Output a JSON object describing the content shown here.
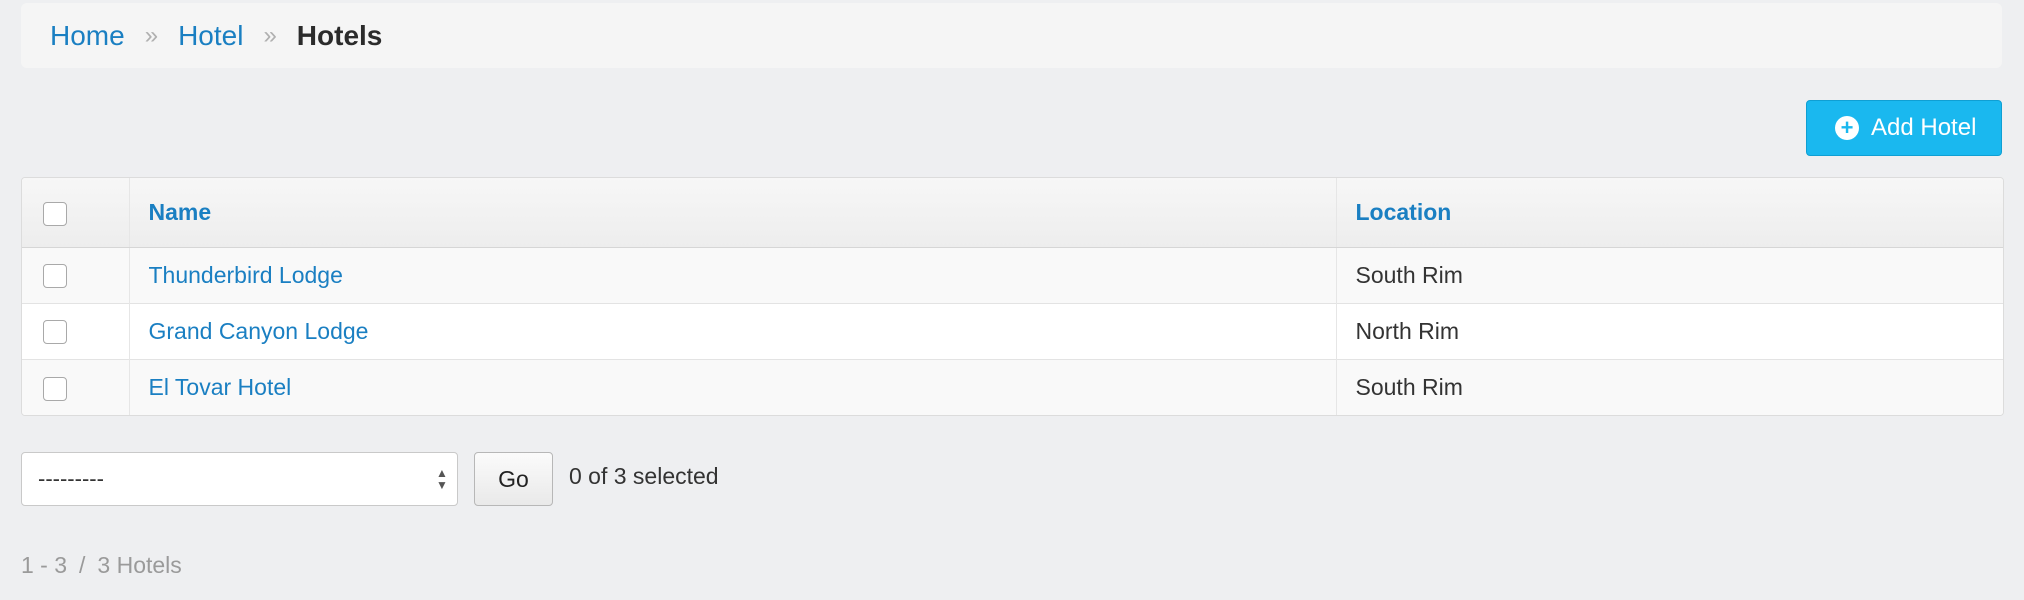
{
  "breadcrumb": {
    "items": [
      {
        "label": "Home"
      },
      {
        "label": "Hotel"
      }
    ],
    "separator": "»",
    "current": "Hotels"
  },
  "toolbar": {
    "add_label": "Add Hotel",
    "add_icon": "plus-circle-icon",
    "add_color": "#1ab8ef"
  },
  "table": {
    "columns": {
      "name": "Name",
      "location": "Location"
    },
    "rows": [
      {
        "name": "Thunderbird Lodge",
        "location": "South Rim"
      },
      {
        "name": "Grand Canyon Lodge",
        "location": "North Rim"
      },
      {
        "name": "El Tovar Hotel",
        "location": "South Rim"
      }
    ]
  },
  "actions": {
    "select_value": "---------",
    "go_label": "Go",
    "selected_text": "0 of 3 selected"
  },
  "pagination": {
    "range": "1 - 3",
    "separator": "/",
    "total": "3 Hotels"
  },
  "colors": {
    "link": "#1a7fc2",
    "background": "#eeeff1"
  }
}
